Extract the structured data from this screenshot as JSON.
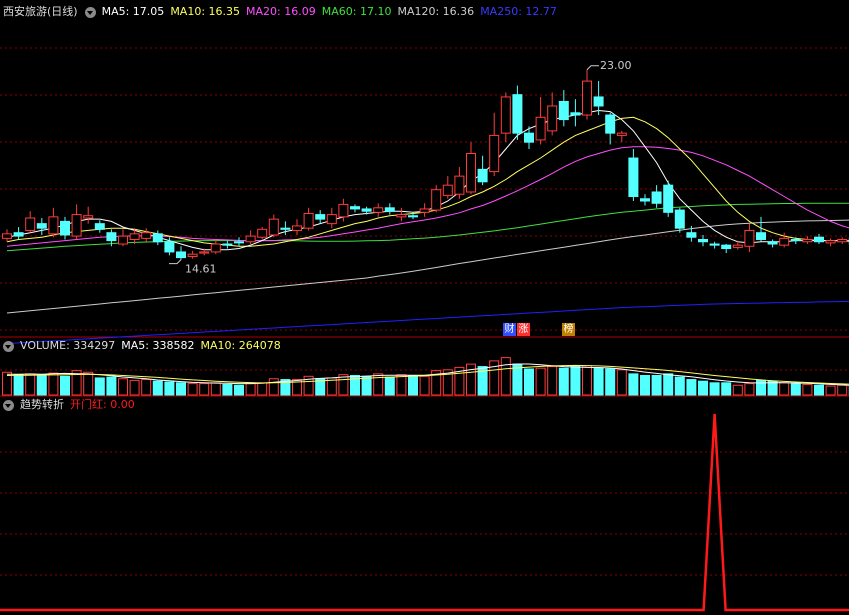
{
  "colors": {
    "up": "#ff3c3c",
    "down": "#54ffff",
    "ma5": "#ffffff",
    "ma10": "#ffff60",
    "ma20": "#ff50ff",
    "ma60": "#40e040",
    "ma120": "#cccccc",
    "ma250": "#2020ff",
    "grid": "#8b0000",
    "signal": "#ff1a1a"
  },
  "header": {
    "title": "西安旅游(日线)",
    "ma5": "MA5: 17.05",
    "ma10": "MA10: 16.35",
    "ma20": "MA20: 16.09",
    "ma60": "MA60: 17.10",
    "ma120": "MA120: 16.36",
    "ma250": "MA250: 12.77"
  },
  "volume_header": {
    "title": "VOLUME: 334297",
    "ma5": "MA5: 338582",
    "ma10": "MA10: 264078"
  },
  "indicator_header": {
    "title": "趋势转折",
    "signal": "开门红: 0.00"
  },
  "badges": {
    "b1": "财",
    "b2": "涨",
    "b3": "榜"
  },
  "chart_data": [
    {
      "type": "candlestick",
      "annotations": {
        "high": "23.00",
        "low": "14.61"
      },
      "price_range": [
        11.5,
        25.2
      ],
      "candles": [
        [
          15.55,
          15.75,
          15.95,
          15.4
        ],
        [
          15.8,
          15.65,
          16.05,
          15.5
        ],
        [
          15.9,
          16.45,
          16.75,
          15.8
        ],
        [
          16.2,
          16.0,
          16.45,
          15.7
        ],
        [
          15.75,
          16.5,
          16.9,
          15.6
        ],
        [
          16.3,
          15.7,
          16.5,
          15.5
        ],
        [
          15.65,
          16.6,
          17.05,
          15.5
        ],
        [
          16.45,
          16.55,
          16.95,
          16.2
        ],
        [
          16.2,
          15.95,
          16.35,
          15.8
        ],
        [
          15.8,
          15.45,
          15.95,
          15.2
        ],
        [
          15.3,
          15.65,
          15.95,
          15.2
        ],
        [
          15.5,
          15.75,
          16.0,
          15.3
        ],
        [
          15.55,
          15.8,
          16.0,
          15.4
        ],
        [
          15.75,
          15.4,
          15.9,
          15.25
        ],
        [
          15.4,
          14.95,
          15.6,
          14.8
        ],
        [
          14.95,
          14.7,
          15.2,
          14.61
        ],
        [
          14.75,
          14.85,
          15.0,
          14.65
        ],
        [
          14.9,
          14.95,
          15.1,
          14.8
        ],
        [
          14.95,
          15.3,
          15.5,
          14.85
        ],
        [
          15.3,
          15.25,
          15.45,
          15.1
        ],
        [
          15.4,
          15.35,
          15.6,
          15.2
        ],
        [
          15.4,
          15.65,
          15.9,
          15.3
        ],
        [
          15.6,
          15.95,
          16.05,
          15.5
        ],
        [
          15.7,
          16.4,
          16.6,
          15.6
        ],
        [
          16.0,
          15.95,
          16.3,
          15.7
        ],
        [
          15.9,
          16.1,
          16.4,
          15.7
        ],
        [
          16.0,
          16.65,
          16.9,
          15.9
        ],
        [
          16.6,
          16.4,
          16.8,
          16.2
        ],
        [
          16.2,
          16.6,
          16.9,
          16.0
        ],
        [
          16.5,
          17.05,
          17.3,
          16.3
        ],
        [
          16.95,
          16.85,
          17.05,
          16.7
        ],
        [
          16.85,
          16.75,
          16.95,
          16.6
        ],
        [
          16.7,
          16.9,
          17.1,
          16.5
        ],
        [
          16.9,
          16.75,
          17.1,
          16.6
        ],
        [
          16.5,
          16.6,
          16.9,
          16.3
        ],
        [
          16.55,
          16.5,
          16.7,
          16.4
        ],
        [
          16.7,
          16.85,
          17.1,
          16.5
        ],
        [
          16.8,
          17.7,
          17.9,
          16.7
        ],
        [
          17.45,
          17.9,
          18.3,
          17.3
        ],
        [
          17.5,
          18.3,
          18.7,
          17.3
        ],
        [
          17.6,
          19.3,
          19.8,
          17.5
        ],
        [
          18.6,
          18.05,
          19.2,
          17.9
        ],
        [
          18.5,
          20.1,
          21.1,
          18.3
        ],
        [
          20.2,
          21.8,
          22.0,
          19.8
        ],
        [
          21.9,
          20.2,
          22.3,
          19.9
        ],
        [
          20.2,
          19.8,
          20.5,
          19.5
        ],
        [
          19.9,
          20.9,
          21.8,
          19.7
        ],
        [
          20.3,
          21.4,
          22.0,
          20.1
        ],
        [
          21.6,
          20.8,
          22.1,
          20.5
        ],
        [
          21.1,
          21.0,
          21.7,
          20.5
        ],
        [
          21.0,
          22.5,
          23.0,
          20.8
        ],
        [
          21.8,
          21.4,
          22.5,
          21.0
        ],
        [
          21.0,
          20.2,
          21.1,
          19.7
        ],
        [
          20.1,
          20.2,
          20.3,
          19.8
        ],
        [
          19.1,
          17.4,
          19.5,
          17.2
        ],
        [
          17.3,
          17.2,
          17.5,
          17.0
        ],
        [
          17.6,
          17.1,
          17.9,
          16.9
        ],
        [
          17.9,
          16.7,
          18.1,
          16.5
        ],
        [
          16.8,
          16.0,
          16.9,
          15.8
        ],
        [
          15.8,
          15.6,
          16.1,
          15.4
        ],
        [
          15.5,
          15.4,
          15.7,
          15.2
        ],
        [
          15.3,
          15.25,
          15.4,
          15.1
        ],
        [
          15.25,
          15.1,
          15.3,
          14.9
        ],
        [
          15.15,
          15.25,
          15.45,
          15.05
        ],
        [
          15.2,
          15.9,
          16.2,
          14.95
        ],
        [
          15.8,
          15.5,
          16.5,
          15.4
        ],
        [
          15.4,
          15.3,
          15.5,
          15.15
        ],
        [
          15.25,
          15.55,
          15.8,
          15.15
        ],
        [
          15.5,
          15.45,
          15.6,
          15.3
        ],
        [
          15.4,
          15.5,
          15.65,
          15.3
        ],
        [
          15.6,
          15.4,
          15.75,
          15.3
        ],
        [
          15.35,
          15.45,
          15.55,
          15.2
        ],
        [
          15.4,
          15.5,
          15.6,
          15.3
        ],
        [
          15.55,
          15.3,
          15.65,
          15.2
        ]
      ],
      "ma5": [
        15.6,
        15.7,
        15.8,
        15.9,
        16.0,
        16.15,
        16.3,
        16.4,
        16.4,
        16.3,
        16.05,
        15.9,
        15.75,
        15.6,
        15.45,
        15.3,
        15.15,
        15.05,
        15.05,
        15.05,
        15.1,
        15.25,
        15.45,
        15.7,
        15.85,
        15.95,
        16.05,
        16.2,
        16.35,
        16.5,
        16.6,
        16.65,
        16.7,
        16.75,
        16.75,
        16.7,
        16.75,
        16.95,
        17.2,
        17.6,
        18.1,
        18.4,
        18.9,
        19.5,
        20.1,
        20.4,
        20.6,
        20.8,
        20.9,
        21.0,
        21.1,
        21.2,
        21.15,
        20.8,
        20.3,
        19.6,
        18.9,
        18.0,
        17.3,
        16.8,
        16.3,
        15.9,
        15.6,
        15.4,
        15.35,
        15.4,
        15.4,
        15.4,
        15.45,
        15.45,
        15.45,
        15.45,
        15.45,
        15.4
      ],
      "ma10": [
        15.4,
        15.5,
        15.55,
        15.6,
        15.7,
        15.8,
        15.85,
        15.9,
        15.95,
        16.0,
        16.0,
        15.95,
        15.85,
        15.75,
        15.65,
        15.55,
        15.45,
        15.35,
        15.3,
        15.25,
        15.2,
        15.2,
        15.25,
        15.3,
        15.4,
        15.5,
        15.6,
        15.75,
        15.9,
        16.05,
        16.2,
        16.3,
        16.45,
        16.55,
        16.6,
        16.65,
        16.7,
        16.8,
        16.95,
        17.15,
        17.4,
        17.6,
        17.85,
        18.15,
        18.5,
        18.8,
        19.1,
        19.45,
        19.8,
        20.1,
        20.3,
        20.5,
        20.7,
        20.85,
        20.9,
        20.7,
        20.4,
        20.0,
        19.5,
        19.0,
        18.4,
        17.8,
        17.2,
        16.7,
        16.3,
        16.0,
        15.8,
        15.65,
        15.55,
        15.5,
        15.45,
        15.45,
        15.45,
        15.45
      ],
      "ma20": [
        15.2,
        15.25,
        15.3,
        15.35,
        15.4,
        15.45,
        15.5,
        15.55,
        15.6,
        15.62,
        15.65,
        15.66,
        15.66,
        15.65,
        15.63,
        15.6,
        15.55,
        15.52,
        15.5,
        15.48,
        15.46,
        15.45,
        15.45,
        15.45,
        15.48,
        15.5,
        15.55,
        15.6,
        15.67,
        15.75,
        15.83,
        15.92,
        16.0,
        16.1,
        16.2,
        16.28,
        16.36,
        16.45,
        16.56,
        16.68,
        16.85,
        17.0,
        17.2,
        17.42,
        17.65,
        17.9,
        18.15,
        18.42,
        18.7,
        18.95,
        19.15,
        19.3,
        19.45,
        19.55,
        19.6,
        19.6,
        19.58,
        19.52,
        19.45,
        19.35,
        19.2,
        19.0,
        18.8,
        18.55,
        18.3,
        18.0,
        17.7,
        17.4,
        17.1,
        16.8,
        16.55,
        16.3,
        16.1,
        15.95
      ],
      "ma60": [
        15.0,
        15.04,
        15.08,
        15.12,
        15.16,
        15.2,
        15.23,
        15.26,
        15.29,
        15.32,
        15.35,
        15.37,
        15.39,
        15.4,
        15.42,
        15.43,
        15.44,
        15.45,
        15.45,
        15.45,
        15.45,
        15.45,
        15.45,
        15.45,
        15.45,
        15.44,
        15.43,
        15.42,
        15.42,
        15.42,
        15.43,
        15.44,
        15.45,
        15.47,
        15.5,
        15.53,
        15.56,
        15.6,
        15.65,
        15.7,
        15.76,
        15.82,
        15.88,
        15.95,
        16.02,
        16.1,
        16.18,
        16.26,
        16.34,
        16.42,
        16.5,
        16.57,
        16.64,
        16.7,
        16.75,
        16.8,
        16.85,
        16.9,
        16.93,
        16.96,
        16.99,
        17.01,
        17.03,
        17.05,
        17.06,
        17.07,
        17.08,
        17.09,
        17.09,
        17.1,
        17.1,
        17.1,
        17.1,
        17.1
      ],
      "ma120": [
        12.25,
        12.3,
        12.35,
        12.4,
        12.45,
        12.5,
        12.55,
        12.6,
        12.65,
        12.7,
        12.75,
        12.8,
        12.85,
        12.9,
        12.95,
        13.0,
        13.05,
        13.1,
        13.15,
        13.2,
        13.25,
        13.3,
        13.35,
        13.4,
        13.45,
        13.5,
        13.55,
        13.6,
        13.65,
        13.7,
        13.75,
        13.8,
        13.88,
        13.95,
        14.02,
        14.1,
        14.18,
        14.26,
        14.35,
        14.44,
        14.52,
        14.6,
        14.68,
        14.76,
        14.84,
        14.92,
        15.0,
        15.08,
        15.16,
        15.24,
        15.32,
        15.4,
        15.48,
        15.56,
        15.63,
        15.7,
        15.77,
        15.84,
        15.91,
        15.98,
        16.04,
        16.1,
        16.15,
        16.19,
        16.22,
        16.25,
        16.27,
        16.29,
        16.31,
        16.32,
        16.33,
        16.34,
        16.35,
        16.36
      ],
      "ma250": [
        10.9,
        10.93,
        10.96,
        10.99,
        11.02,
        11.05,
        11.08,
        11.11,
        11.14,
        11.17,
        11.2,
        11.23,
        11.26,
        11.29,
        11.32,
        11.35,
        11.38,
        11.41,
        11.44,
        11.47,
        11.5,
        11.53,
        11.56,
        11.59,
        11.62,
        11.65,
        11.68,
        11.71,
        11.74,
        11.77,
        11.8,
        11.83,
        11.86,
        11.89,
        11.92,
        11.95,
        11.98,
        12.01,
        12.04,
        12.07,
        12.1,
        12.13,
        12.16,
        12.19,
        12.22,
        12.25,
        12.28,
        12.31,
        12.34,
        12.37,
        12.4,
        12.43,
        12.46,
        12.49,
        12.51,
        12.53,
        12.55,
        12.57,
        12.59,
        12.61,
        12.63,
        12.65,
        12.66,
        12.67,
        12.68,
        12.69,
        12.7,
        12.71,
        12.72,
        12.73,
        12.74,
        12.75,
        12.76,
        12.77
      ]
    },
    {
      "type": "bar",
      "volume": [
        280000,
        250000,
        260000,
        240000,
        270000,
        230000,
        300000,
        280000,
        210000,
        220000,
        200000,
        180000,
        190000,
        170000,
        160000,
        150000,
        140000,
        140000,
        150000,
        130000,
        120000,
        140000,
        150000,
        200000,
        190000,
        190000,
        230000,
        200000,
        210000,
        250000,
        240000,
        230000,
        260000,
        220000,
        250000,
        240000,
        230000,
        300000,
        310000,
        340000,
        380000,
        350000,
        420000,
        460000,
        380000,
        320000,
        330000,
        350000,
        330000,
        350000,
        360000,
        330000,
        320000,
        310000,
        260000,
        240000,
        240000,
        260000,
        220000,
        190000,
        170000,
        150000,
        150000,
        120000,
        140000,
        180000,
        170000,
        150000,
        140000,
        130000,
        120000,
        110000,
        120000,
        110000
      ],
      "ma5": [
        255000,
        256000,
        258000,
        256000,
        262000,
        266000,
        262000,
        260000,
        250000,
        236000,
        222000,
        210000,
        200000,
        185000,
        175000,
        165000,
        155000,
        150000,
        146000,
        144000,
        140000,
        140000,
        144000,
        158000,
        168000,
        178000,
        194000,
        204000,
        210000,
        222000,
        226000,
        232000,
        240000,
        244000,
        244000,
        242000,
        244000,
        256000,
        270000,
        290000,
        312000,
        330000,
        350000,
        372000,
        382000,
        382000,
        372000,
        360000,
        350000,
        345000,
        340000,
        338000,
        332000,
        320000,
        300000,
        282000,
        266000,
        250000,
        238000,
        224000,
        206000,
        188000,
        172000,
        160000,
        150000,
        148000,
        152000,
        150000,
        148000,
        144000,
        138000,
        130000,
        124000,
        118000
      ],
      "ma10": [
        240000,
        242000,
        244000,
        246000,
        248000,
        250000,
        252000,
        254000,
        252000,
        248000,
        240000,
        232000,
        224000,
        216000,
        206000,
        196000,
        186000,
        178000,
        170000,
        164000,
        158000,
        152000,
        148000,
        150000,
        154000,
        160000,
        166000,
        174000,
        182000,
        190000,
        198000,
        206000,
        214000,
        220000,
        226000,
        232000,
        238000,
        246000,
        256000,
        268000,
        280000,
        294000,
        308000,
        322000,
        334000,
        344000,
        352000,
        358000,
        362000,
        364000,
        362000,
        358000,
        352000,
        344000,
        334000,
        324000,
        314000,
        302000,
        288000,
        272000,
        256000,
        240000,
        226000,
        212000,
        198000,
        186000,
        176000,
        168000,
        160000,
        154000,
        148000,
        142000,
        137000,
        132000
      ],
      "max": 480000
    },
    {
      "type": "line",
      "name": "开门红",
      "values": [
        0,
        0,
        0,
        0,
        0,
        0,
        0,
        0,
        0,
        0,
        0,
        0,
        0,
        0,
        0,
        0,
        0,
        0,
        0,
        0,
        0,
        0,
        0,
        0,
        0,
        0,
        0,
        0,
        0,
        0,
        0,
        0,
        0,
        0,
        0,
        0,
        0,
        0,
        0,
        0,
        0,
        0,
        0,
        0,
        0,
        0,
        0,
        0,
        0,
        0,
        0,
        0,
        0,
        0,
        0,
        0,
        0,
        0,
        0,
        0,
        0,
        1,
        0,
        0,
        0,
        0,
        0,
        0,
        0,
        0,
        0,
        0,
        0,
        0
      ],
      "peak_index": 61
    }
  ]
}
